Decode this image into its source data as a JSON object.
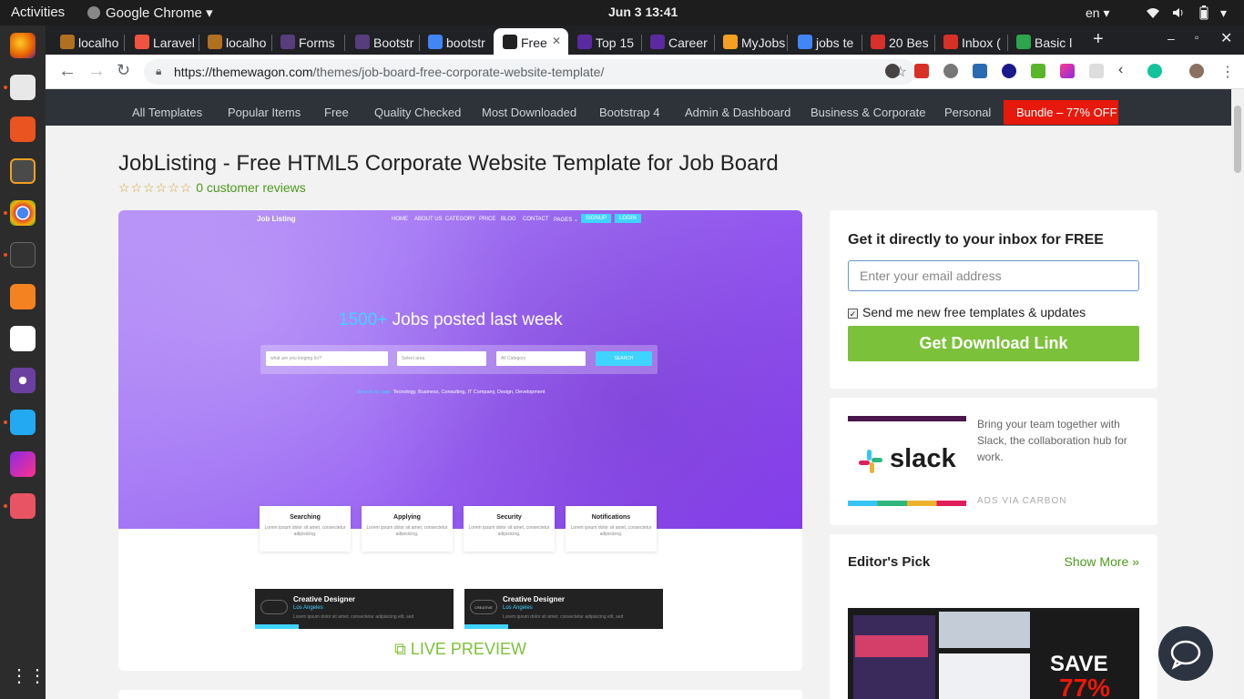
{
  "system": {
    "activities": "Activities",
    "app_name": "Google Chrome",
    "clock": "Jun 3  13:41",
    "lang": "en"
  },
  "tabs": [
    {
      "label": "localho",
      "fav_color": "#b07020"
    },
    {
      "label": "Laravel",
      "fav_color": "#f05340"
    },
    {
      "label": "localho",
      "fav_color": "#b07020"
    },
    {
      "label": "Forms",
      "fav_color": "#563d7c"
    },
    {
      "label": "Bootstr",
      "fav_color": "#563d7c"
    },
    {
      "label": "bootstr",
      "fav_color": "#4285f4"
    },
    {
      "label": "Free",
      "fav_color": "#222222",
      "active": true
    },
    {
      "label": "Top 15",
      "fav_color": "#5b2aa0"
    },
    {
      "label": "Career",
      "fav_color": "#5b2aa0"
    },
    {
      "label": "MyJobs",
      "fav_color": "#f4a020"
    },
    {
      "label": "jobs te",
      "fav_color": "#4285f4"
    },
    {
      "label": "20 Bes",
      "fav_color": "#d9302c"
    },
    {
      "label": "Inbox (",
      "fav_color": "#d93025"
    },
    {
      "label": "Basic l",
      "fav_color": "#2da44e"
    }
  ],
  "new_tab": "+",
  "omnibox": {
    "url_host": "https://themewagon.com",
    "url_path": "/themes/job-board-free-corporate-website-template/"
  },
  "site_nav": {
    "links": [
      "All Templates",
      "Popular Items",
      "Free",
      "Quality Checked",
      "Most Downloaded",
      "Bootstrap 4",
      "Admin & Dashboard",
      "Business & Corporate",
      "Personal"
    ],
    "bundle": "Bundle – 77% OFF"
  },
  "product": {
    "title": "JobListing - Free HTML5 Corporate Website Template for Job Board",
    "stars": "☆☆☆☆☆☆",
    "reviews": "0 customer reviews",
    "live_preview": "LIVE PREVIEW"
  },
  "preview": {
    "brand": "Job Listing",
    "nav": [
      "HOME",
      "ABOUT US",
      "CATEGORY",
      "PRICE",
      "BLOG",
      "CONTACT",
      "PAGES ⌄"
    ],
    "signup": "SIGNUP",
    "login": "LOGIN",
    "hero_num": "1500+",
    "hero_text": " Jobs posted last week",
    "search_placeholder": "what are you looging for?",
    "select_area": "Select area",
    "all_category": "All Category",
    "search_btn": "SEARCH",
    "tags_label": "Search by tags:",
    "tags": "Tecnology, Business, Consulting, IT Company, Design, Development",
    "features": [
      {
        "title": "Searching",
        "desc": "Lorem ipsum dolor sit amet, consectetur adipisicing."
      },
      {
        "title": "Applying",
        "desc": "Lorem ipsum dolor sit amet, consectetur adipisicing."
      },
      {
        "title": "Security",
        "desc": "Lorem ipsum dolor sit amet, consectetur adipisicing."
      },
      {
        "title": "Notifications",
        "desc": "Lorem ipsum dolor sit amet, consectetur adipisicing."
      }
    ],
    "jobs": [
      {
        "title": "Creative Designer",
        "loc": "Los Angeles",
        "desc": "Lorem ipsum dolor sit amet, consectetur adipisicing elit, sed",
        "logo": ""
      },
      {
        "title": "Creative Designer",
        "loc": "Los Angeles",
        "desc": "Lorem ipsum dolor sit amet, consectetur adipisicing elit, sed",
        "logo": "CREATIVE"
      }
    ]
  },
  "signup_box": {
    "heading": "Get it directly to your inbox for FREE",
    "email_placeholder": "Enter your email address",
    "checkbox_label": "Send me new free templates & updates",
    "checked": true,
    "button": "Get Download Link"
  },
  "ad": {
    "brand": "slack",
    "text": "Bring your team together with Slack, the collaboration hub for work.",
    "via": "ADS VIA CARBON"
  },
  "editors_pick": {
    "heading": "Editor's Pick",
    "show_more": "Show More »",
    "banner_save": "SAVE",
    "banner_pct": "77%"
  },
  "colors": {
    "accent_green": "#7cc13a",
    "bundle_red": "#e7190c",
    "nav_bg": "#2e3339",
    "hero_purple": "#a070f4",
    "cyan": "#3fd4ff"
  }
}
